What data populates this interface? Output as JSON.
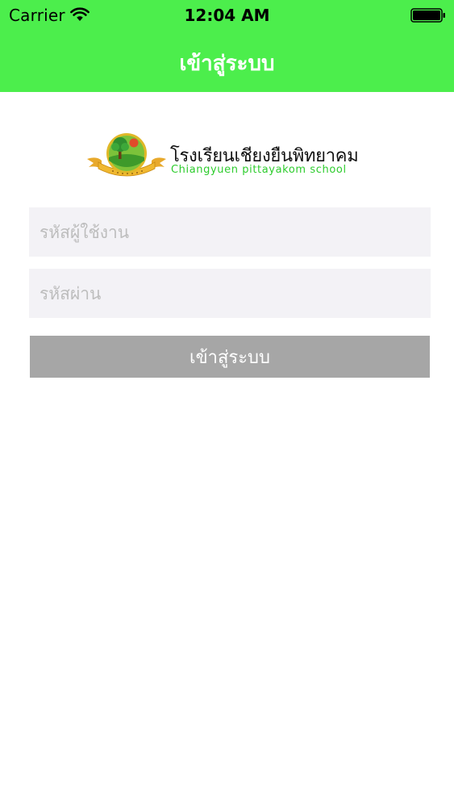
{
  "status_bar": {
    "carrier": "Carrier",
    "time": "12:04 AM"
  },
  "nav": {
    "title": "เข้าสู่ระบบ"
  },
  "logo": {
    "name_th": "โรงเรียนเชียงยืนพิทยาคม",
    "name_en": "Chiangyuen pittayakom school"
  },
  "form": {
    "username_placeholder": "รหัสผู้ใช้งาน",
    "username_value": "",
    "password_placeholder": "รหัสผ่าน",
    "password_value": "",
    "login_label": "เข้าสู่ระบบ"
  },
  "colors": {
    "header_bg": "#4cee4c",
    "field_bg": "#f3f2f6",
    "button_bg": "#a6a6a6",
    "logo_en_text": "#2ecc2e"
  },
  "icons": [
    "wifi-icon",
    "battery-icon",
    "school-emblem-icon"
  ]
}
